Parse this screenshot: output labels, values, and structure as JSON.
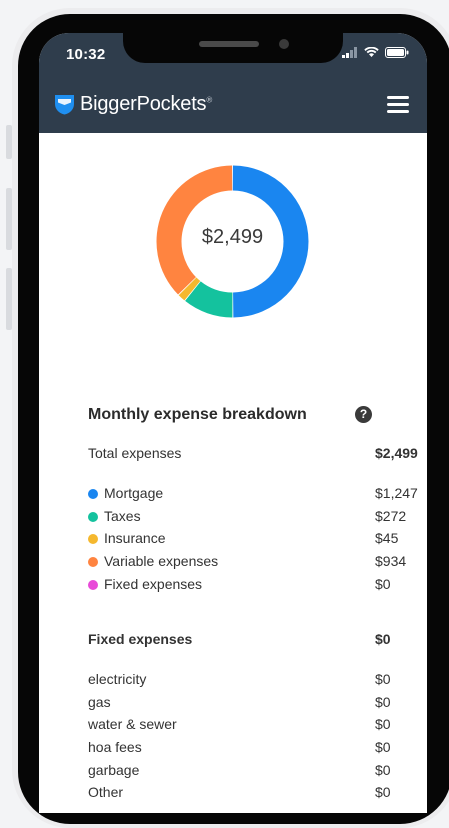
{
  "status": {
    "time": "10:32"
  },
  "header": {
    "brand": "BiggerPockets",
    "trademark": "®"
  },
  "donut": {
    "total": "$2,499",
    "segments": [
      {
        "name": "Mortgage",
        "value": 1247,
        "color": "#1a86f0"
      },
      {
        "name": "Taxes",
        "value": 272,
        "color": "#14c29e"
      },
      {
        "name": "Insurance",
        "value": 45,
        "color": "#f5b82e"
      },
      {
        "name": "Variable expenses",
        "value": 934,
        "color": "#ff8440"
      },
      {
        "name": "Fixed expenses",
        "value": 0,
        "color": "#e84ad8"
      }
    ]
  },
  "breakdown": {
    "title": "Monthly expense breakdown",
    "help_icon": "?",
    "total_label": "Total expenses",
    "total_value": "$2,499",
    "items": [
      {
        "label": "Mortgage",
        "value": "$1,247",
        "color": "#1a86f0"
      },
      {
        "label": "Taxes",
        "value": "$272",
        "color": "#14c29e"
      },
      {
        "label": "Insurance",
        "value": "$45",
        "color": "#f5b82e"
      },
      {
        "label": "Variable expenses",
        "value": "$934",
        "color": "#ff8440"
      },
      {
        "label": "Fixed expenses",
        "value": "$0",
        "color": "#e84ad8"
      }
    ]
  },
  "fixed": {
    "title": "Fixed expenses",
    "total": "$0",
    "items": [
      {
        "label": "electricity",
        "value": "$0"
      },
      {
        "label": "gas",
        "value": "$0"
      },
      {
        "label": "water & sewer",
        "value": "$0"
      },
      {
        "label": "hoa fees",
        "value": "$0"
      },
      {
        "label": "garbage",
        "value": "$0"
      },
      {
        "label": "Other",
        "value": "$0"
      }
    ]
  }
}
